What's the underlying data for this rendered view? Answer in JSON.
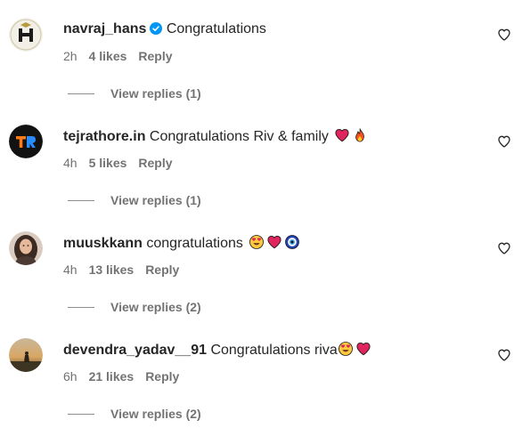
{
  "comments": [
    {
      "username": "navraj_hans",
      "verified": true,
      "text": "Congratulations",
      "emojis": [],
      "time": "2h",
      "likes": "4 likes",
      "reply": "Reply",
      "view_replies": "View replies (1)",
      "avatar": "navraj-avatar"
    },
    {
      "username": "tejrathore.in",
      "verified": false,
      "text": "Congratulations Riv & family",
      "emojis": [
        "red-heart-emoji",
        "fire-emoji"
      ],
      "time": "4h",
      "likes": "5 likes",
      "reply": "Reply",
      "view_replies": "View replies (1)",
      "avatar": "tr-logo-avatar"
    },
    {
      "username": "muuskkann",
      "verified": false,
      "text": "congratulations",
      "emojis": [
        "heart-eyes-emoji",
        "red-heart-emoji",
        "nazar-amulet-emoji"
      ],
      "time": "4h",
      "likes": "13 likes",
      "reply": "Reply",
      "view_replies": "View replies (2)",
      "avatar": "portrait-avatar"
    },
    {
      "username": "devendra_yadav__91",
      "verified": false,
      "text": "Congratulations riva",
      "emojis": [
        "heart-eyes-emoji",
        "red-heart-emoji"
      ],
      "time": "6h",
      "likes": "21 likes",
      "reply": "Reply",
      "view_replies": "View replies (2)",
      "avatar": "sunset-avatar"
    }
  ],
  "colors": {
    "text": "#262626",
    "secondary": "#737373",
    "verified": "#0095f6",
    "heart_emoji": "#e0245e"
  }
}
